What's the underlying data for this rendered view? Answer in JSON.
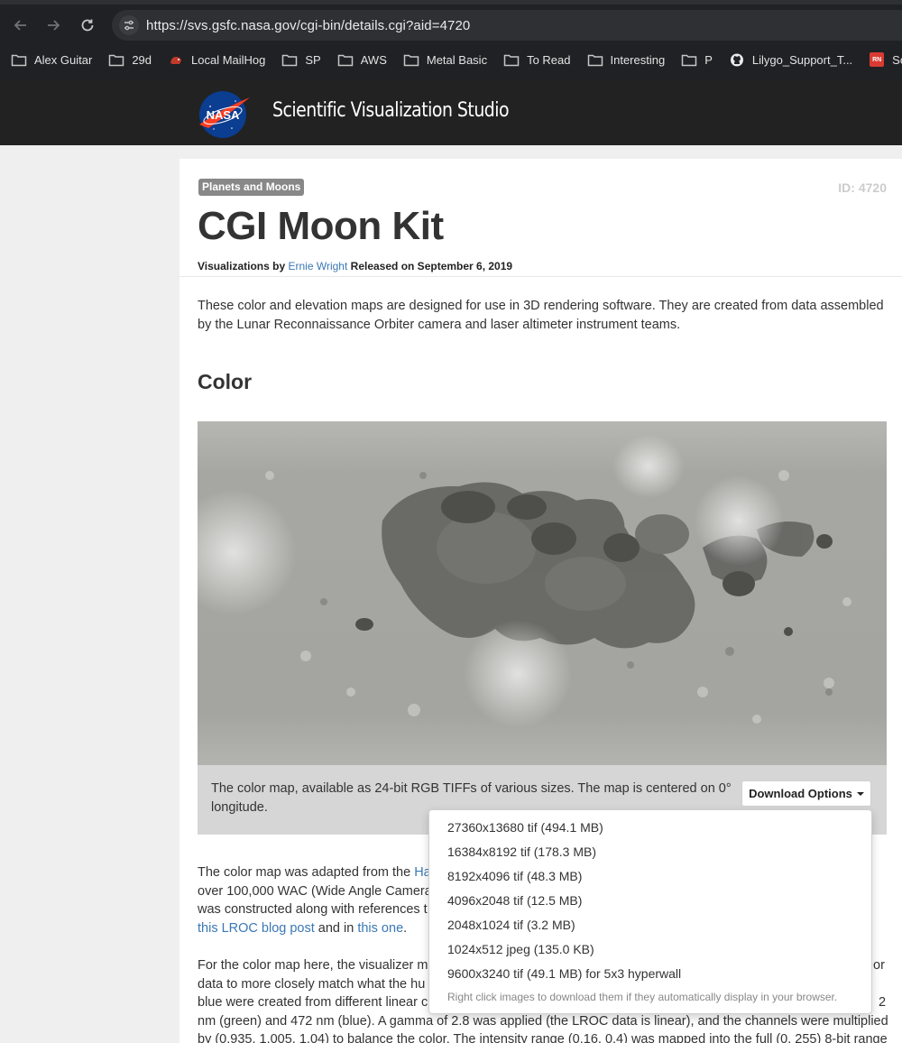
{
  "browser": {
    "url": "https://svs.gsfc.nasa.gov/cgi-bin/details.cgi?aid=4720",
    "bookmarks": [
      {
        "label": "Alex Guitar",
        "icon": "folder-icon"
      },
      {
        "label": "29d",
        "icon": "folder-icon"
      },
      {
        "label": "Local MailHog",
        "icon": "mailhog-icon"
      },
      {
        "label": "SP",
        "icon": "folder-icon"
      },
      {
        "label": "AWS",
        "icon": "folder-icon"
      },
      {
        "label": "Metal Basic",
        "icon": "folder-icon"
      },
      {
        "label": "To Read",
        "icon": "folder-icon"
      },
      {
        "label": "Interesting",
        "icon": "folder-icon"
      },
      {
        "label": "P",
        "icon": "folder-icon"
      },
      {
        "label": "Lilygo_Support_T...",
        "icon": "github-icon"
      },
      {
        "label": "Som",
        "icon": "rn-icon"
      }
    ],
    "rn_badge": "RN"
  },
  "header": {
    "logo_text": "NASA",
    "studio": "Scientific Visualization Studio"
  },
  "page": {
    "category": "Planets and Moons",
    "id_label": "ID: 4720",
    "title": "CGI Moon Kit",
    "credits_prefix": "Visualizations by",
    "author": "Ernie Wright",
    "released": "Released on September 6, 2019",
    "intro": "These color and elevation maps are designed for use in 3D rendering software. They are created from data assembled by the Lunar Reconnaissance Orbiter camera and laser altimeter instrument teams.",
    "section_color": "Color",
    "caption": "The color map, available as 24-bit RGB TIFFs of various sizes. The map is centered on 0° longitude.",
    "download_button": "Download Options",
    "para1": {
      "line1_a": "The color map was adapted from the ",
      "line1_link": "Ha",
      "line2": "over 100,000 WAC (Wide Angle Camera",
      "line3": "was constructed along with references t",
      "line4_link1": "this LROC blog post",
      "line4_mid": " and in ",
      "line4_link2": "this one",
      "line4_end": "."
    },
    "para2": {
      "line1": "For the color map here, the visualizer m",
      "line1_end": "or",
      "line2": "data to more closely match what the hu",
      "line3": "blue were created from different linear c",
      "line3_end": "2",
      "line4": "nm (green) and 472 nm (blue). A gamma of 2.8 was applied (the LROC data is linear), and the channels were multiplied",
      "line5": "by (0.935, 1.005, 1.04) to balance the color. The intensity range (0.16, 0.4) was mapped into the full (0, 255) 8-bit range"
    }
  },
  "downloads": {
    "items": [
      "27360x13680 tif (494.1 MB)",
      "16384x8192 tif (178.3 MB)",
      "8192x4096 tif (48.3 MB)",
      "4096x2048 tif (12.5 MB)",
      "2048x1024 tif (3.2 MB)",
      "1024x512 jpeg (135.0 KB)",
      "9600x3240 tif (49.1 MB) for 5x3 hyperwall"
    ],
    "note": "Right click images to download them if they automatically display in your browser."
  }
}
